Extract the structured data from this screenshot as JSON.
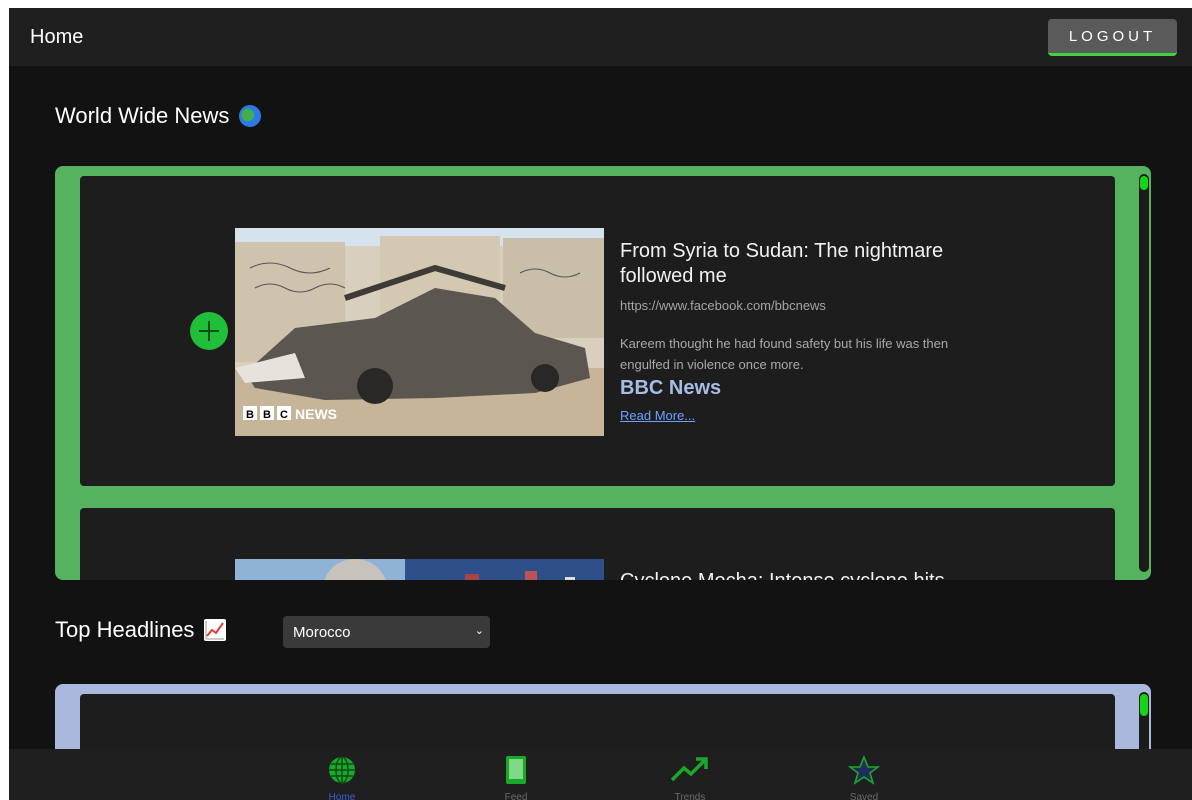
{
  "header": {
    "title": "Home",
    "logout_label": "LOGOUT"
  },
  "world_news": {
    "title": "World Wide News",
    "cards": [
      {
        "headline": "From Syria to Sudan: The nightmare followed me",
        "url": "https://www.facebook.com/bbcnews",
        "description": "Kareem thought he had found safety but his life was then engulfed in violence once more.",
        "outlet": "BBC News",
        "read_more": "Read More...",
        "image_caption": "NEWS"
      },
      {
        "headline": "Cyclone Mocha: Intense cyclone hits"
      }
    ]
  },
  "top_headlines": {
    "title": "Top Headlines",
    "selected_country": "Morocco"
  },
  "bottom_nav": {
    "items": [
      {
        "label": "Home",
        "icon": "globe-icon",
        "active": true
      },
      {
        "label": "Feed",
        "icon": "tablet-icon",
        "active": false
      },
      {
        "label": "Trends",
        "icon": "trend-up-icon",
        "active": false
      },
      {
        "label": "Saved",
        "icon": "star-icon",
        "active": false
      }
    ]
  },
  "colors": {
    "accent_green": "#3fd13f",
    "carousel_green": "#55b25e",
    "carousel_blue": "#a9b8dc",
    "outlet_blue": "#a6bde6",
    "link_blue": "#6ea2ff"
  }
}
